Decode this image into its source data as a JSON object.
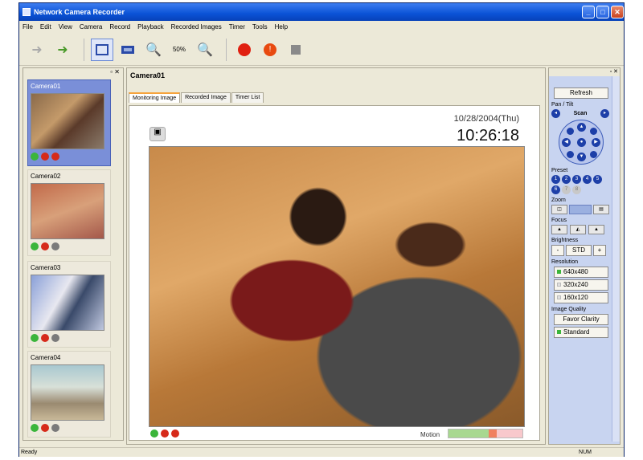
{
  "window": {
    "title": "Network Camera Recorder"
  },
  "menu": [
    "File",
    "Edit",
    "View",
    "Camera",
    "Record",
    "Playback",
    "Recorded Images",
    "Timer",
    "Tools",
    "Help"
  ],
  "toolbar": {
    "zoom_value": "50%"
  },
  "left_panel": {
    "cameras": [
      {
        "name": "Camera01",
        "selected": true
      },
      {
        "name": "Camera02",
        "selected": false
      },
      {
        "name": "Camera03",
        "selected": false
      },
      {
        "name": "Camera04",
        "selected": false
      }
    ]
  },
  "main": {
    "camera_title": "Camera01",
    "tabs": [
      "Monitoring Image",
      "Recorded Image",
      "Timer List"
    ],
    "date": "10/28/2004(Thu)",
    "time": "10:26:18",
    "motion_label": "Motion"
  },
  "right_panel": {
    "refresh": "Refresh",
    "pan_tilt_label": "Pan / Tilt",
    "scan_label": "Scan",
    "preset_label": "Preset",
    "preset_numbers": [
      "1",
      "2",
      "3",
      "4",
      "5",
      "6",
      "7",
      "8"
    ],
    "zoom_label": "Zoom",
    "focus_label": "Focus",
    "brightness_label": "Brightness",
    "brightness_minus": "-",
    "brightness_std": "STD",
    "brightness_plus": "+",
    "resolution_label": "Resolution",
    "resolutions": [
      "640x480",
      "320x240",
      "160x120"
    ],
    "image_quality_label": "Image Quality",
    "favor_clarity": "Favor Clarity",
    "standard": "Standard"
  },
  "status": {
    "left": "Ready",
    "right": "NUM"
  },
  "colors": {
    "title_bar": "#0a52d6",
    "selected_camera": "#7a8fd8",
    "record_red": "#d62a1a"
  }
}
